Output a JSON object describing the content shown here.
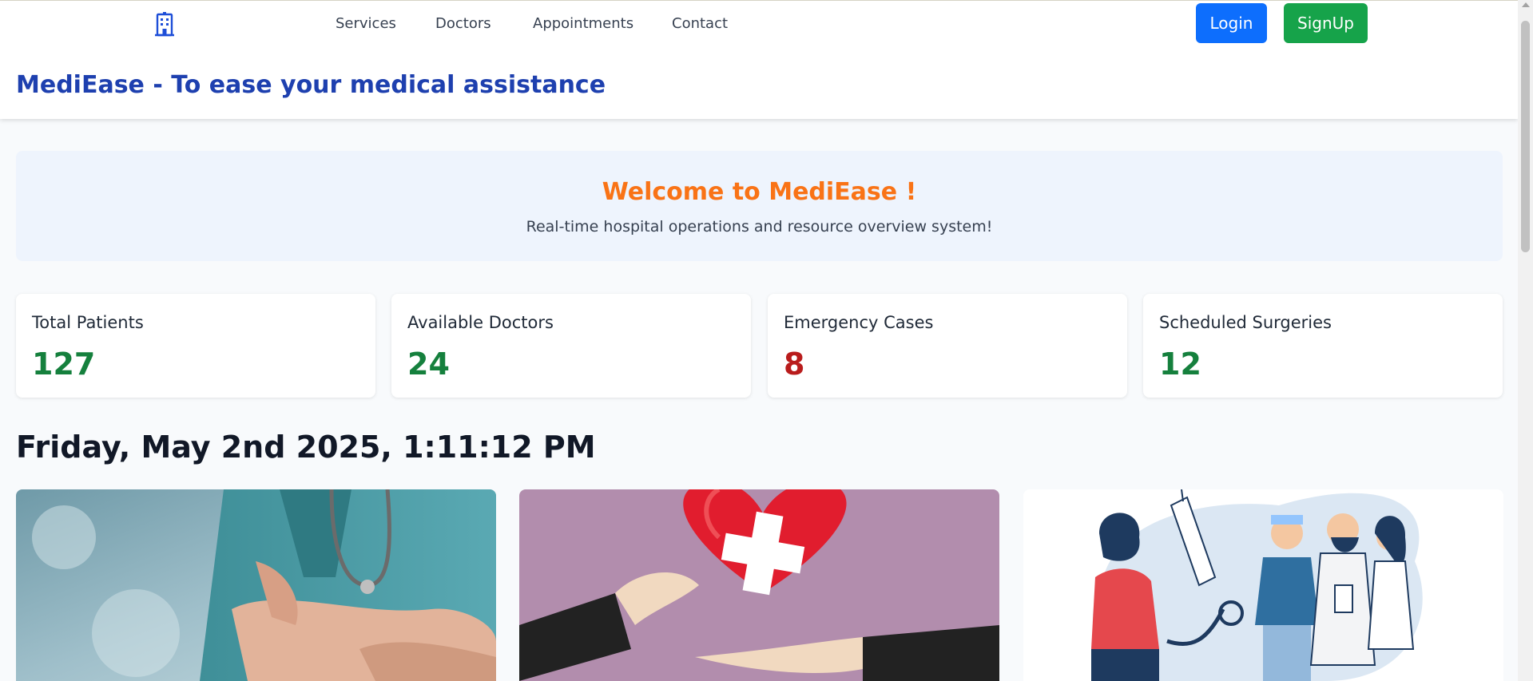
{
  "nav": {
    "items": [
      {
        "label": "Services"
      },
      {
        "label": "Doctors"
      },
      {
        "label": "Appointments"
      },
      {
        "label": "Contact"
      }
    ],
    "login_label": "Login",
    "signup_label": "SignUp"
  },
  "header": {
    "logo_icon": "hospital-building-icon",
    "title": "MediEase - To ease your medical assistance"
  },
  "welcome": {
    "title": "Welcome to MediEase !",
    "subtitle": "Real-time hospital operations and resource overview system!"
  },
  "stats": [
    {
      "label": "Total Patients",
      "value": "127",
      "color": "#15803d"
    },
    {
      "label": "Available Doctors",
      "value": "24",
      "color": "#15803d"
    },
    {
      "label": "Emergency Cases",
      "value": "8",
      "color": "#b91c1c"
    },
    {
      "label": "Scheduled Surgeries",
      "value": "12",
      "color": "#15803d"
    }
  ],
  "datetime": "Friday, May 2nd 2025, 1:11:12 PM",
  "colors": {
    "brand_blue": "#1e40af",
    "accent_orange": "#f97316",
    "login_button": "#0d6efd",
    "signup_button": "#16a34a"
  },
  "images": [
    {
      "name": "doctor-stethoscope-photo"
    },
    {
      "name": "heart-donation-illustration"
    },
    {
      "name": "medical-team-illustration"
    }
  ]
}
